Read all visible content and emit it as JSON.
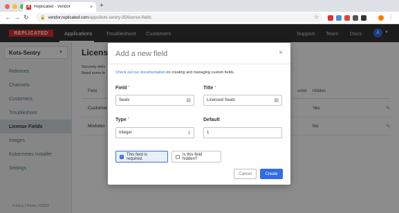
{
  "browser": {
    "tab_title": "Replicated - Vendor",
    "favicon_letter": "R",
    "url_host": "vendor.replicated.com",
    "url_path": "/apps/kots-sentry-35/license-fields"
  },
  "header": {
    "logo": "REPLICATED",
    "nav": [
      "Applications",
      "Troubleshoot",
      "Customers"
    ],
    "right_nav": [
      "Support",
      "Team",
      "Docs"
    ],
    "avatar_letter": "A"
  },
  "sidebar": {
    "app_name": "Kots-Sentry",
    "items": [
      "Releases",
      "Channels",
      "Customers",
      "Troubleshoot",
      "License Fields",
      "Images",
      "Kubernetes Installer",
      "Settings"
    ],
    "footer": "Privacy  |  Terms  |  ©2020"
  },
  "main": {
    "title": "License Fields",
    "desc_line1": "Securely deliv",
    "desc_line2": "Need some fe",
    "columns": [
      "Field",
      "uired",
      "Hidden"
    ],
    "rows": [
      {
        "field": "Customer",
        "hidden": "Yes"
      },
      {
        "field": "Modules",
        "hidden": "No"
      }
    ]
  },
  "modal": {
    "title": "Add a new field",
    "info_link": "Check out our documentation",
    "info_rest": " on creating and managing custom fields.",
    "field_label": "Field",
    "field_value": "Seats",
    "title_label": "Title",
    "title_value": "Licensed Seats",
    "type_label": "Type",
    "type_value": "Integer",
    "default_label": "Default",
    "default_value": "1",
    "required_label": "This field is required.",
    "required_checked": true,
    "hidden_label": "Is this field hidden?",
    "hidden_checked": false,
    "cancel_label": "Cancel",
    "create_label": "Create"
  }
}
